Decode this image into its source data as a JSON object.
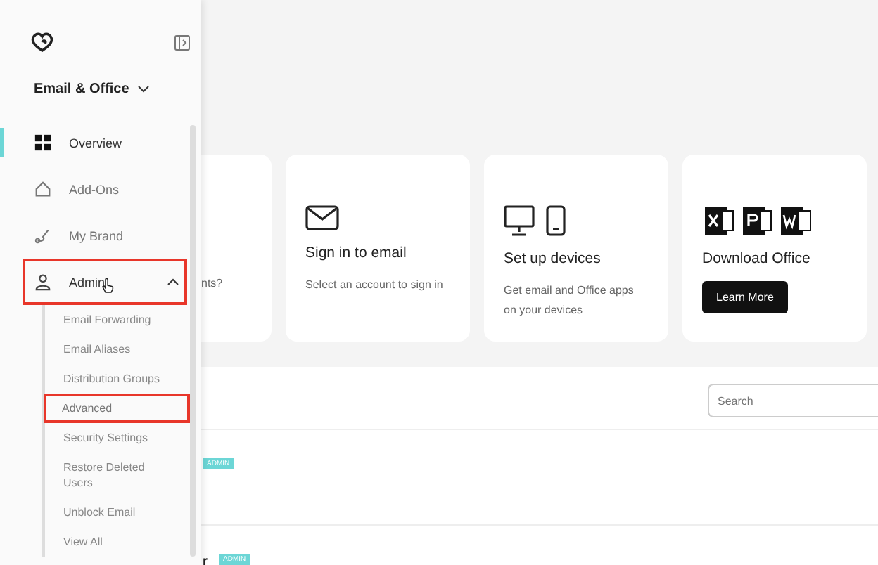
{
  "sidebar": {
    "product": "Email & Office",
    "items": [
      {
        "label": "Overview",
        "selected": true,
        "highlighted": false
      },
      {
        "label": "Add-Ons",
        "selected": false,
        "highlighted": false
      },
      {
        "label": "My Brand",
        "selected": false,
        "highlighted": false
      },
      {
        "label": "Admin",
        "selected": false,
        "highlighted": true,
        "expanded": true,
        "children": [
          {
            "label": "Email Forwarding",
            "highlighted": false
          },
          {
            "label": "Email Aliases",
            "highlighted": false
          },
          {
            "label": "Distribution Groups",
            "highlighted": false
          },
          {
            "label": "Advanced",
            "highlighted": true
          },
          {
            "label": "Security Settings",
            "highlighted": false
          },
          {
            "label": "Restore Deleted Users",
            "highlighted": false
          },
          {
            "label": "Unblock Email",
            "highlighted": false
          },
          {
            "label": "View All",
            "highlighted": false
          }
        ]
      }
    ]
  },
  "cards": [
    {
      "kind": "partial",
      "text": "nts?"
    },
    {
      "kind": "email",
      "title": "Sign in to email",
      "text": "Select an account to sign in"
    },
    {
      "kind": "devices",
      "title": "Set up devices",
      "text": "Get email and Office apps on your devices"
    },
    {
      "kind": "office",
      "title": "Download Office",
      "button": "Learn More"
    }
  ],
  "search": {
    "placeholder": "Search"
  },
  "users": [
    {
      "badge": "ADMIN"
    },
    {
      "name": "r",
      "badge": "ADMIN"
    }
  ]
}
